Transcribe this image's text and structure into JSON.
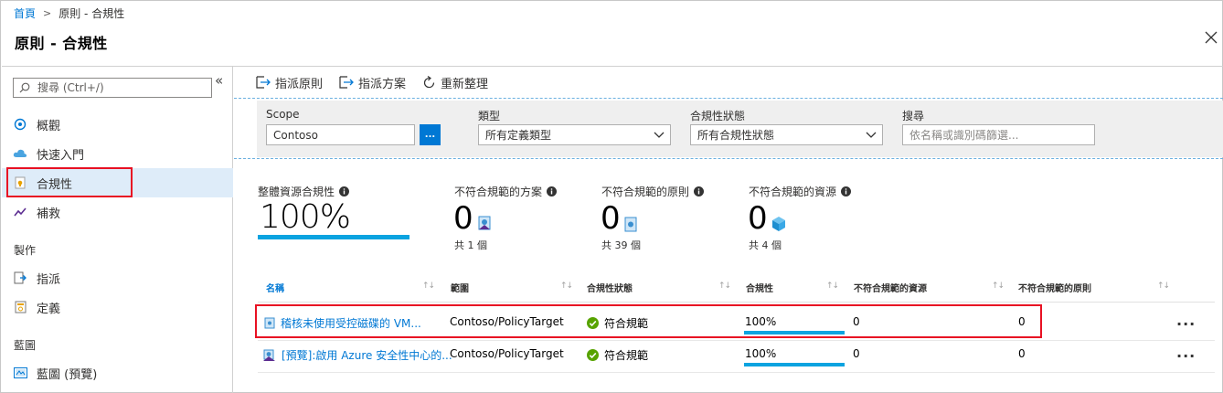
{
  "breadcrumb": {
    "home": "首頁",
    "separator": ">",
    "current": "原則 - 合規性"
  },
  "page_title": "原則 - 合規性",
  "sidebar": {
    "search_placeholder": "搜尋 (Ctrl+/)",
    "collapse": "«",
    "items": [
      {
        "label": "概觀",
        "icon": "overview-icon"
      },
      {
        "label": "快速入門",
        "icon": "cloud-icon"
      },
      {
        "label": "合規性",
        "icon": "compliance-icon",
        "selected": true
      },
      {
        "label": "補救",
        "icon": "remediation-icon"
      }
    ],
    "section_authoring": "製作",
    "authoring_items": [
      {
        "label": "指派",
        "icon": "assign-icon"
      },
      {
        "label": "定義",
        "icon": "definition-icon"
      }
    ],
    "section_blueprints": "藍圖",
    "blueprint_items": [
      {
        "label": "藍圖 (預覽)",
        "icon": "blueprint-icon"
      }
    ]
  },
  "toolbar": {
    "assign_policy": "指派原則",
    "assign_initiative": "指派方案",
    "refresh": "重新整理"
  },
  "filters": {
    "scope_label": "Scope",
    "scope_value": "Contoso",
    "browse_label": "...",
    "type_label": "類型",
    "type_value": "所有定義類型",
    "state_label": "合規性狀態",
    "state_value": "所有合規性狀態",
    "search_label": "搜尋",
    "search_placeholder": "依名稱或識別碼篩選..."
  },
  "summary": {
    "overall_label": "整體資源合規性",
    "overall_value": "100%",
    "overall_fraction": 1.0,
    "initiatives_label": "不符合規範的方案",
    "initiatives_value": "0",
    "initiatives_total": "共 1 個",
    "policies_label": "不符合規範的原則",
    "policies_value": "0",
    "policies_total": "共 39 個",
    "resources_label": "不符合規範的資源",
    "resources_value": "0",
    "resources_total": "共 4 個"
  },
  "table": {
    "columns": [
      "名稱",
      "範圍",
      "合規性狀態",
      "合規性",
      "不符合規範的資源",
      "不符合規範的原則"
    ],
    "sort_glyph": "↑↓",
    "rows": [
      {
        "name": "稽核未使用受控磁碟的 VM...",
        "scope": "Contoso/PolicyTarget",
        "state": "符合規範",
        "compliance": "100%",
        "compliance_fraction": 1.0,
        "noncompliant_resources": "0",
        "noncompliant_policies": "0",
        "more": "..."
      },
      {
        "name": "[預覽]:啟用 Azure 安全性中心的...",
        "scope": "Contoso/PolicyTarget",
        "state": "符合規範",
        "compliance": "100%",
        "compliance_fraction": 1.0,
        "noncompliant_resources": "0",
        "noncompliant_policies": "0",
        "more": "..."
      }
    ]
  },
  "colors": {
    "accent": "#0078d4",
    "bar": "#0ba3e0",
    "highlight": "#e81123",
    "selected_bg": "#deecf9",
    "ok": "#57a300"
  }
}
